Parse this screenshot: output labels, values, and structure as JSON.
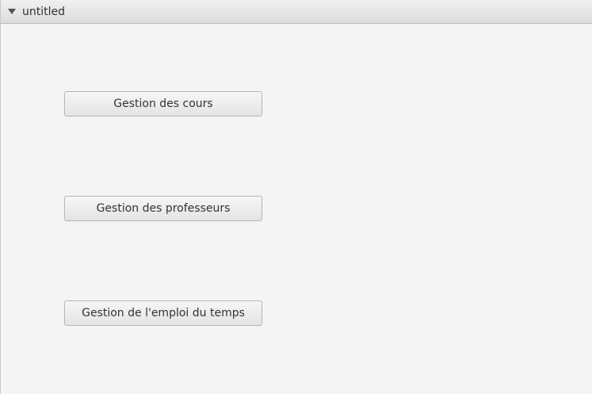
{
  "titled_pane": {
    "title": "untitled",
    "toggle_icon": "triangle-down-icon"
  },
  "buttons": {
    "courses": "Gestion des cours",
    "teachers": "Gestion des professeurs",
    "timetable": "Gestion de l'emploi du temps"
  }
}
